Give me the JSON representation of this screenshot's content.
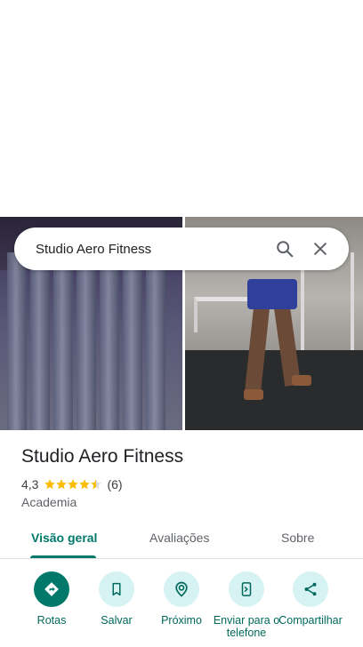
{
  "search": {
    "query": "Studio Aero Fitness"
  },
  "place": {
    "name": "Studio Aero Fitness",
    "rating": "4,3",
    "rating_value": 4.3,
    "review_count": "(6)",
    "category": "Academia"
  },
  "tabs": [
    {
      "label": "Visão geral",
      "active": true
    },
    {
      "label": "Avaliações",
      "active": false
    },
    {
      "label": "Sobre",
      "active": false
    }
  ],
  "actions": [
    {
      "label": "Rotas",
      "icon": "directions-icon",
      "primary": true
    },
    {
      "label": "Salvar",
      "icon": "bookmark-icon",
      "primary": false
    },
    {
      "label": "Próximo",
      "icon": "nearby-icon",
      "primary": false
    },
    {
      "label": "Enviar para o telefone",
      "icon": "send-to-phone-icon",
      "primary": false
    },
    {
      "label": "Compartilhar",
      "icon": "share-icon",
      "primary": false
    }
  ],
  "colors": {
    "accent": "#00796b",
    "star": "#fbbc04",
    "action_bg": "#d7f2f2"
  }
}
